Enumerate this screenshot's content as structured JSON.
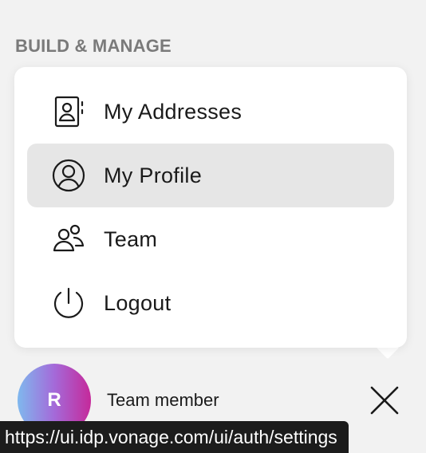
{
  "section": {
    "heading": "BUILD & MANAGE"
  },
  "menu": {
    "items": [
      {
        "label": "My Addresses",
        "icon": "address-book-icon",
        "active": false
      },
      {
        "label": "My Profile",
        "icon": "user-circle-icon",
        "active": true
      },
      {
        "label": "Team",
        "icon": "team-icon",
        "active": false
      },
      {
        "label": "Logout",
        "icon": "power-icon",
        "active": false
      }
    ]
  },
  "user": {
    "initial": "R",
    "role": "Team member",
    "avatar_gradient": [
      "#7fb8ee",
      "#a46ad9",
      "#c5299a"
    ]
  },
  "close_icon": "close-icon",
  "status_bar": {
    "url": "https://ui.idp.vonage.com/ui/auth/settings"
  },
  "colors": {
    "background": "#f2f2f2",
    "menu_background": "#ffffff",
    "active_item": "#e6e6e6",
    "heading": "#7a7a7a",
    "text": "#1a1a1a"
  }
}
